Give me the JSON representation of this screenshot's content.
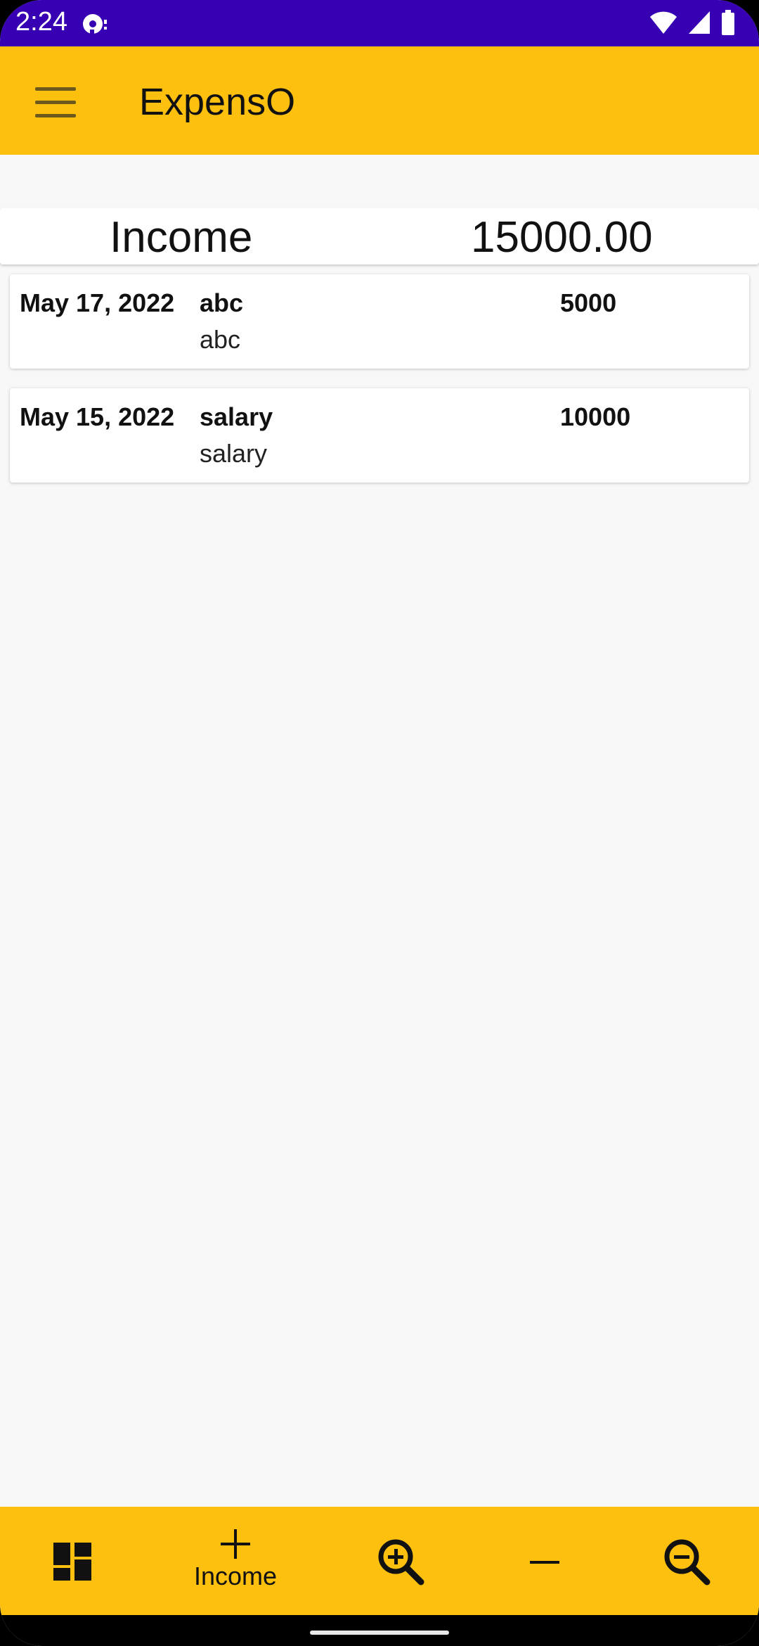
{
  "status_bar": {
    "time": "2:24"
  },
  "app_bar": {
    "title": "ExpensO"
  },
  "summary": {
    "label": "Income",
    "total": "15000.00"
  },
  "entries": [
    {
      "date": "May 17, 2022",
      "title": "abc",
      "note": "abc",
      "amount": "5000"
    },
    {
      "date": "May 15, 2022",
      "title": "salary",
      "note": "salary",
      "amount": "10000"
    }
  ],
  "bottom_nav": {
    "items": [
      {
        "icon": "dashboard-icon",
        "label": ""
      },
      {
        "icon": "plus-icon",
        "label": "Income"
      },
      {
        "icon": "zoom-in-icon",
        "label": ""
      },
      {
        "icon": "minus-icon",
        "label": ""
      },
      {
        "icon": "zoom-out-icon",
        "label": ""
      }
    ]
  },
  "colors": {
    "status_bar": "#3700b3",
    "accent": "#fdc00f",
    "background": "#f8f8f8"
  }
}
